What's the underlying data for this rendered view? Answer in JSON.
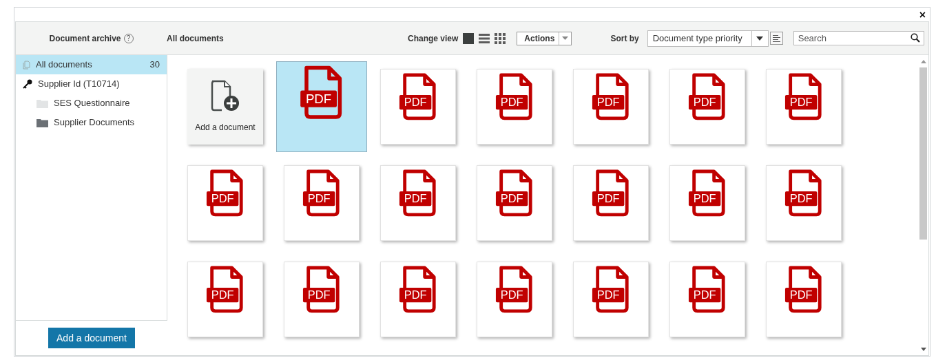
{
  "close_label": "×",
  "header": {
    "title": "Document archive",
    "help": "?",
    "breadcrumb": "All documents",
    "change_view_label": "Change view",
    "views": [
      {
        "kind": "tile",
        "selected": true
      },
      {
        "kind": "list",
        "selected": false
      },
      {
        "kind": "grid",
        "selected": false
      }
    ],
    "actions": "Actions",
    "sort_label": "Sort by",
    "sort_value": "Document type priority",
    "search": {
      "placeholder": "Search"
    }
  },
  "sidebar": {
    "items": [
      {
        "kind": "all",
        "label": "All documents",
        "count": "30",
        "selected": true
      },
      {
        "kind": "key",
        "label": "Supplier Id (T10714)",
        "selected": false,
        "children": [
          {
            "kind": "folder",
            "label": "SES Questionnaire",
            "empty": true,
            "selected": false
          },
          {
            "kind": "folder",
            "label": "Supplier Documents",
            "empty": false,
            "selected": false
          }
        ]
      }
    ],
    "add_button": "Add a document"
  },
  "tiles": [
    {
      "kind": "add",
      "label": "Add a document",
      "selected": false
    },
    {
      "kind": "pdf",
      "label": "PDF",
      "selected": true
    },
    {
      "kind": "pdf",
      "label": "PDF",
      "selected": false
    },
    {
      "kind": "pdf",
      "label": "PDF",
      "selected": false
    },
    {
      "kind": "pdf",
      "label": "PDF",
      "selected": false
    },
    {
      "kind": "pdf",
      "label": "PDF",
      "selected": false
    },
    {
      "kind": "pdf",
      "label": "PDF",
      "selected": false
    },
    {
      "kind": "pdf",
      "label": "PDF",
      "selected": false
    },
    {
      "kind": "pdf",
      "label": "PDF",
      "selected": false
    },
    {
      "kind": "pdf",
      "label": "PDF",
      "selected": false
    },
    {
      "kind": "pdf",
      "label": "PDF",
      "selected": false
    },
    {
      "kind": "pdf",
      "label": "PDF",
      "selected": false
    },
    {
      "kind": "pdf",
      "label": "PDF",
      "selected": false
    },
    {
      "kind": "pdf",
      "label": "PDF",
      "selected": false
    },
    {
      "kind": "pdf",
      "label": "PDF",
      "selected": false
    },
    {
      "kind": "pdf",
      "label": "PDF",
      "selected": false
    },
    {
      "kind": "pdf",
      "label": "PDF",
      "selected": false
    },
    {
      "kind": "pdf",
      "label": "PDF",
      "selected": false
    },
    {
      "kind": "pdf",
      "label": "PDF",
      "selected": false
    },
    {
      "kind": "pdf",
      "label": "PDF",
      "selected": false
    },
    {
      "kind": "pdf",
      "label": "PDF",
      "selected": false
    }
  ]
}
